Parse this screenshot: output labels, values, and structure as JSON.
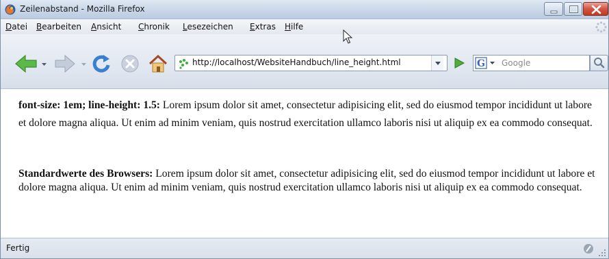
{
  "window": {
    "title": "Zeilenabstand - Mozilla Firefox"
  },
  "menu": {
    "items": [
      "Datei",
      "Bearbeiten",
      "Ansicht",
      "Chronik",
      "Lesezeichen",
      "Extras",
      "Hilfe"
    ]
  },
  "toolbar": {
    "url": "http://localhost/WebsiteHandbuch/line_height.html",
    "search_engine_letter": "G",
    "search_placeholder": "Google"
  },
  "content": {
    "p1_label": "font-size: 1em; line-height: 1.5:",
    "p1_text": " Lorem ipsum dolor sit amet, consectetur adipisicing elit, sed do eiusmod tempor incididunt ut labore et dolore magna aliqua. Ut enim ad minim veniam, quis nostrud exercitation ullamco laboris nisi ut aliquip ex ea commodo consequat.",
    "p2_label": "Standardwerte des Browsers:",
    "p2_text": " Lorem ipsum dolor sit amet, consectetur adipisicing elit, sed do eiusmod tempor incididunt ut labore et dolore magna aliqua. Ut enim ad minim veniam, quis nostrud exercitation ullamco laboris nisi ut aliquip ex ea commodo consequat."
  },
  "status": {
    "text": "Fertig"
  },
  "icons": {
    "app": "firefox-icon",
    "back": "back-arrow-icon",
    "forward": "forward-arrow-icon",
    "reload": "reload-icon",
    "stop": "stop-icon",
    "home": "home-icon",
    "go": "go-arrow-icon",
    "search": "magnifier-icon"
  },
  "colors": {
    "titlebar": "#c9d7e8",
    "close_button": "#d4543f",
    "nav_green": "#4fae3b"
  }
}
